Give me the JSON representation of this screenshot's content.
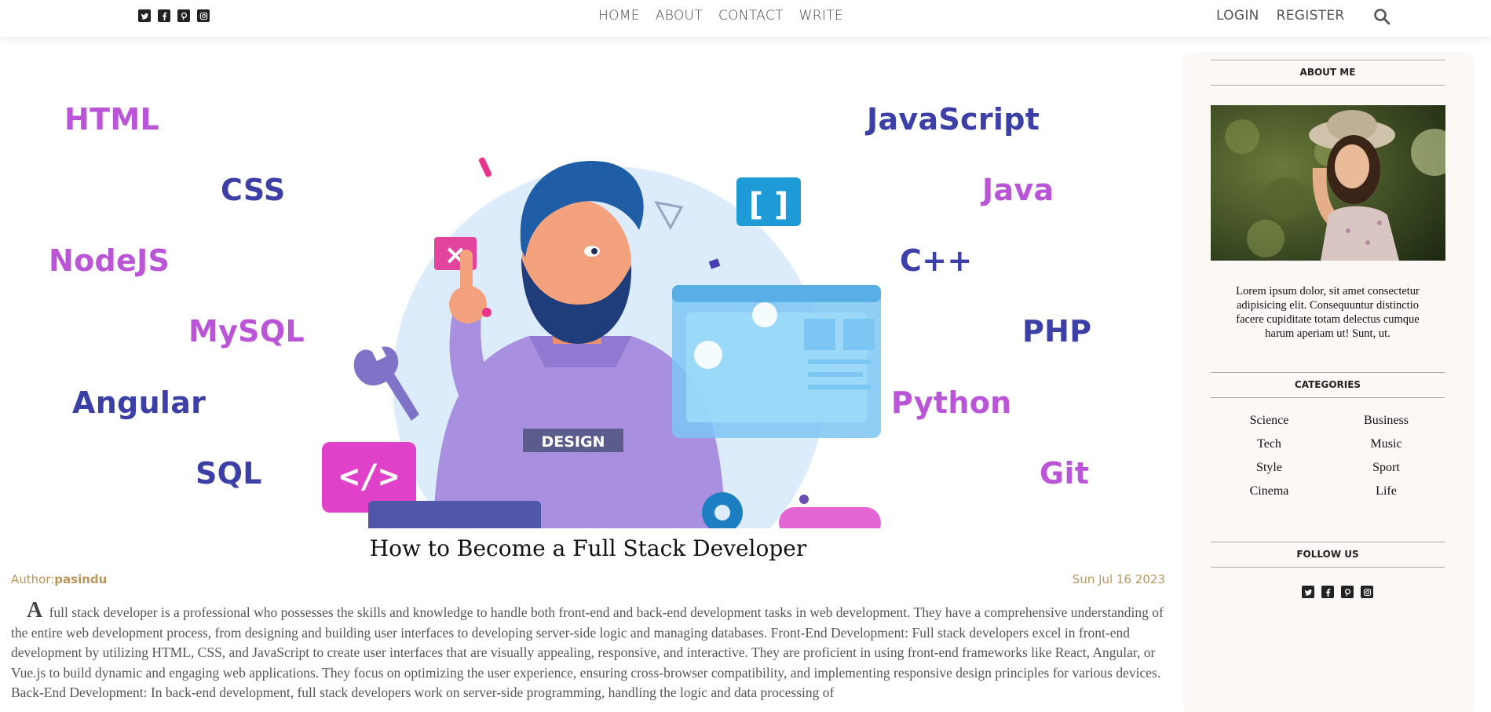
{
  "header": {
    "social_icons": [
      "twitter-icon",
      "facebook-icon",
      "pinterest-icon",
      "instagram-icon"
    ],
    "nav": [
      "HOME",
      "ABOUT",
      "CONTACT",
      "WRITE"
    ],
    "auth": [
      "LOGIN",
      "REGISTER"
    ],
    "search_icon": "search-icon"
  },
  "hero": {
    "illustration_text": "DESIGN",
    "tech_labels_left": [
      "HTML",
      "CSS",
      "NodeJS",
      "MySQL",
      "Angular",
      "SQL"
    ],
    "tech_labels_right": [
      "JavaScript",
      "Java",
      "C++",
      "PHP",
      "Python",
      "Git"
    ]
  },
  "post": {
    "title": "How to Become a Full Stack Developer",
    "author_label": "Author:",
    "author": "pasindu",
    "date": "Sun Jul 16 2023",
    "body": "A full stack developer is a professional who possesses the skills and knowledge to handle both front-end and back-end development tasks in web development. They have a comprehensive understanding of the entire web development process, from designing and building user interfaces to developing server-side logic and managing databases. Front-End Development: Full stack developers excel in front-end development by utilizing HTML, CSS, and JavaScript to create user interfaces that are visually appealing, responsive, and interactive. They are proficient in using front-end frameworks like React, Angular, or Vue.js to build dynamic and engaging web applications. They focus on optimizing the user experience, ensuring cross-browser compatibility, and implementing responsive design principles for various devices. Back-End Development: In back-end development, full stack developers work on server-side programming, handling the logic and data processing of"
  },
  "sidebar": {
    "about_title": "ABOUT ME",
    "about_text": "Lorem ipsum dolor, sit amet consectetur adipisicing elit. Consequuntur distinctio facere cupiditate totam delectus cumque harum aperiam ut! Sunt, ut.",
    "categories_title": "CATEGORIES",
    "categories": [
      "Science",
      "Business",
      "Tech",
      "Music",
      "Style",
      "Sport",
      "Cinema",
      "Life"
    ],
    "follow_title": "FOLLOW US"
  },
  "colors": {
    "accent": "#b9965a",
    "tech_blue": "#3b3fa6",
    "tech_purple": "#b955d6"
  }
}
